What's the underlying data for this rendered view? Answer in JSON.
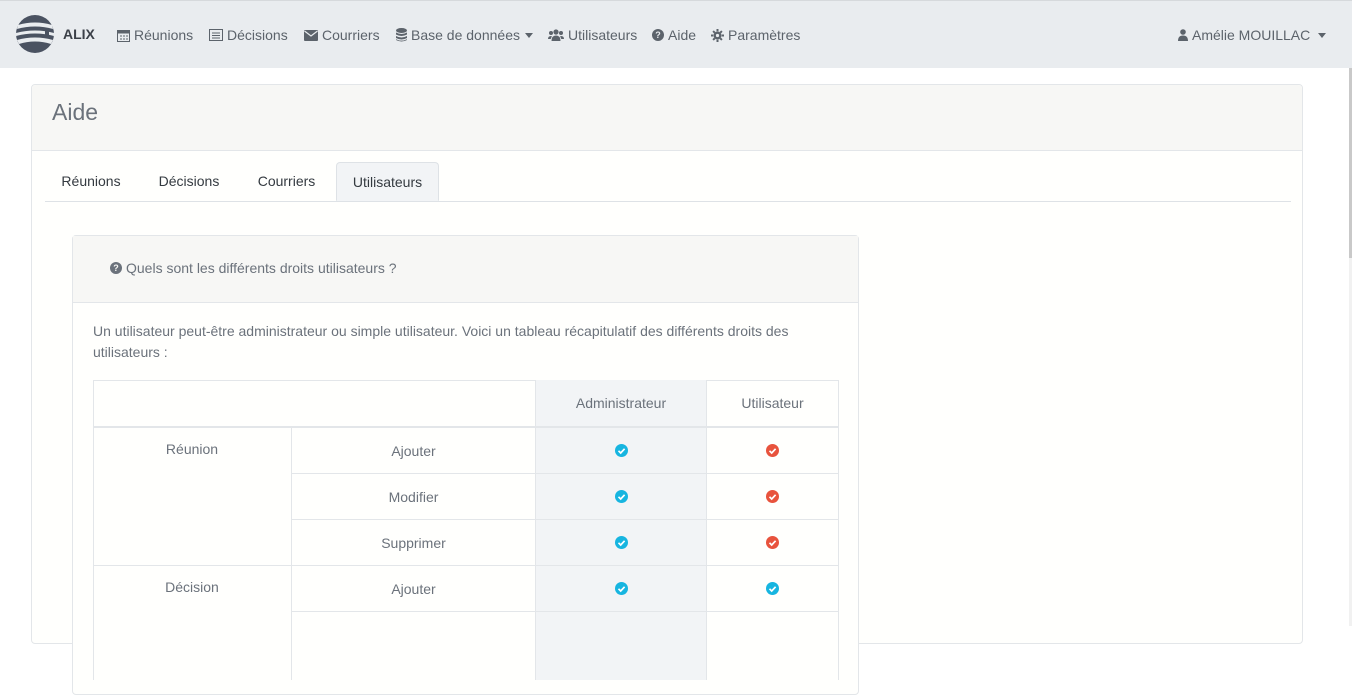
{
  "navbar": {
    "brand": "ALIX",
    "items": [
      {
        "label": "Réunions",
        "icon": "calendar-icon"
      },
      {
        "label": "Décisions",
        "icon": "list-icon"
      },
      {
        "label": "Courriers",
        "icon": "envelope-icon"
      },
      {
        "label": "Base de données",
        "icon": "database-icon"
      },
      {
        "label": "Utilisateurs",
        "icon": "users-icon"
      },
      {
        "label": "Aide",
        "icon": "question-circle-icon"
      },
      {
        "label": "Paramètres",
        "icon": "gear-icon"
      }
    ],
    "user": "Amélie MOUILLAC"
  },
  "page": {
    "title": "Aide",
    "tabs": [
      {
        "label": "Réunions"
      },
      {
        "label": "Décisions"
      },
      {
        "label": "Courriers"
      },
      {
        "label": "Utilisateurs",
        "active": true
      }
    ]
  },
  "faq": {
    "question": "Quels sont les différents droits utilisateurs ?",
    "intro": "Un utilisateur peut-être administrateur ou simple utilisateur. Voici un tableau récapitulatif des différents droits des utilisateurs :",
    "table": {
      "headers": [
        "Administrateur",
        "Utilisateur"
      ],
      "groups": [
        {
          "name": "Réunion",
          "rows": [
            {
              "action": "Ajouter",
              "admin": "yes",
              "user": "no"
            },
            {
              "action": "Modifier",
              "admin": "yes",
              "user": "no"
            },
            {
              "action": "Supprimer",
              "admin": "yes",
              "user": "no"
            }
          ]
        },
        {
          "name": "Décision",
          "rows": [
            {
              "action": "Ajouter",
              "admin": "yes",
              "user": "yes"
            }
          ]
        }
      ]
    }
  },
  "colors": {
    "yes": "#17b5e0",
    "no": "#e8533d"
  }
}
